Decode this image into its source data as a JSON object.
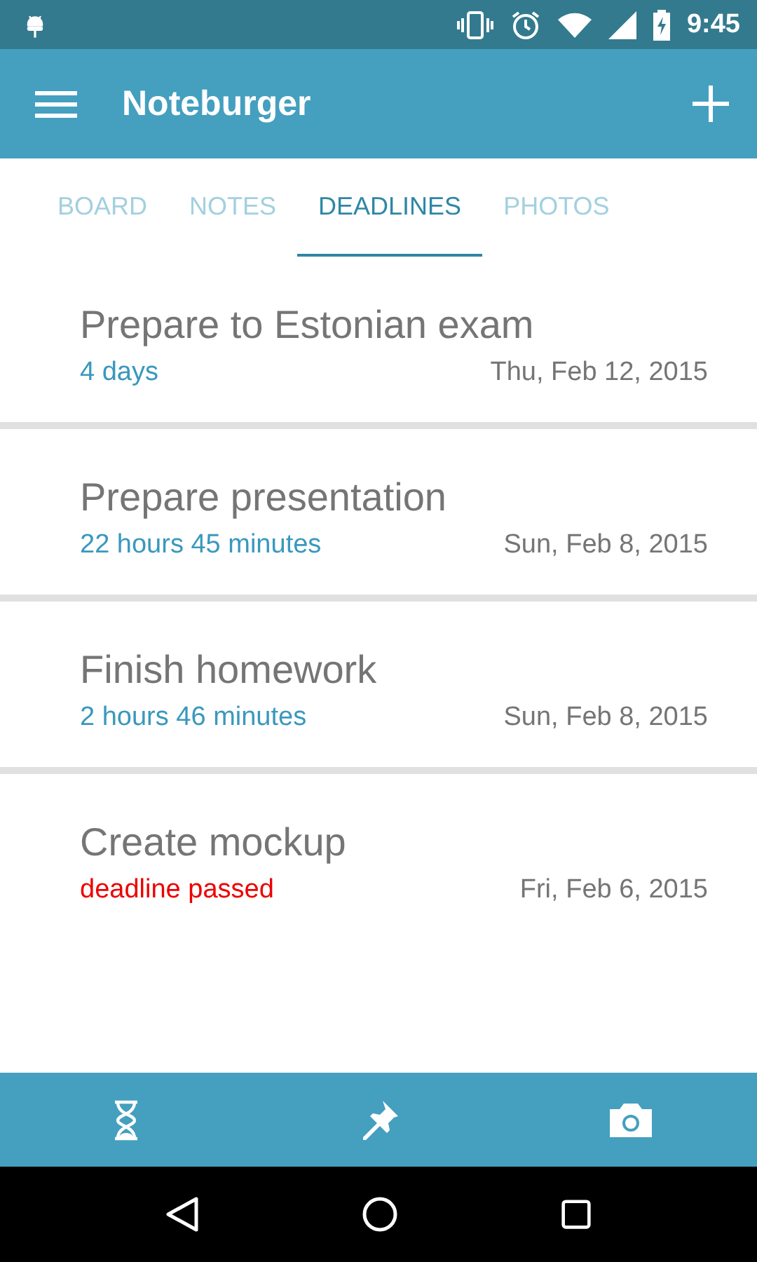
{
  "status_bar": {
    "time": "9:45"
  },
  "app_bar": {
    "title": "Noteburger"
  },
  "tabs": [
    {
      "label": "BOARD",
      "selected": false
    },
    {
      "label": "NOTES",
      "selected": false
    },
    {
      "label": "DEADLINES",
      "selected": true
    },
    {
      "label": "PHOTOS",
      "selected": false
    }
  ],
  "deadlines": [
    {
      "title": "Prepare to Estonian exam",
      "remaining": "4 days",
      "passed": false,
      "date": "Thu, Feb 12, 2015"
    },
    {
      "title": "Prepare presentation",
      "remaining": "22 hours 45 minutes",
      "passed": false,
      "date": "Sun, Feb 8, 2015"
    },
    {
      "title": "Finish homework",
      "remaining": "2 hours 46 minutes",
      "passed": false,
      "date": "Sun, Feb 8, 2015"
    },
    {
      "title": "Create mockup",
      "remaining": "deadline passed",
      "passed": true,
      "date": "Fri, Feb 6, 2015"
    }
  ],
  "bottom_bar": [
    {
      "kind": "hourglass"
    },
    {
      "kind": "pin"
    },
    {
      "kind": "camera"
    }
  ]
}
